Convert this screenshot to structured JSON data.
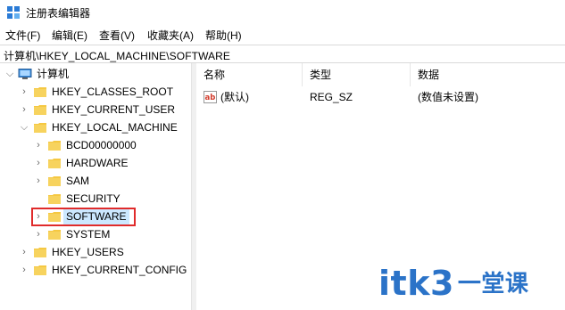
{
  "window": {
    "title": "注册表编辑器"
  },
  "menu": [
    "文件(F)",
    "编辑(E)",
    "查看(V)",
    "收藏夹(A)",
    "帮助(H)"
  ],
  "address": "计算机\\HKEY_LOCAL_MACHINE\\SOFTWARE",
  "tree": {
    "root": "计算机",
    "hives": [
      "HKEY_CLASSES_ROOT",
      "HKEY_CURRENT_USER",
      "HKEY_LOCAL_MACHINE",
      "HKEY_USERS",
      "HKEY_CURRENT_CONFIG"
    ],
    "hklm_children": [
      "BCD00000000",
      "HARDWARE",
      "SAM",
      "SECURITY",
      "SOFTWARE",
      "SYSTEM"
    ],
    "selected": "SOFTWARE"
  },
  "list": {
    "columns": [
      "名称",
      "类型",
      "数据"
    ],
    "rows": [
      {
        "name": "(默认)",
        "type": "REG_SZ",
        "data": "(数值未设置)"
      }
    ]
  },
  "watermark": {
    "latin": "itk3",
    "cn": "一堂课"
  },
  "colors": {
    "selection": "#cce8ff",
    "highlight_border": "#e02b2b",
    "folder": "#f5c842",
    "watermark": "#2b73c8"
  }
}
